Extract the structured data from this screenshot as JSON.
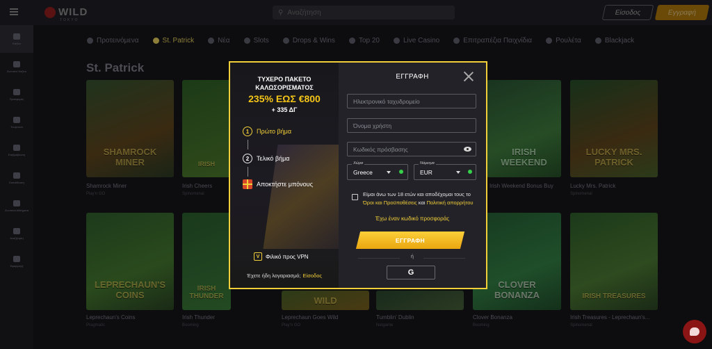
{
  "topbar": {
    "logo": "WILD",
    "logo_sub": "TOKYO",
    "search_placeholder": "Αναζήτηση",
    "login_label": "Είσοδος",
    "register_label": "Εγγραφή"
  },
  "sidebar": {
    "items": [
      {
        "label": "Καζίνο",
        "icon": "casino-icon"
      },
      {
        "label": "Ζωντανό Καζίνο",
        "icon": "home-icon"
      },
      {
        "label": "Προσφορές",
        "icon": "gift-icon"
      },
      {
        "label": "Τουρνουά",
        "icon": "trophy-icon"
      },
      {
        "label": "Επιβράβευση",
        "icon": "star-icon"
      },
      {
        "label": "Εκπαίδευση",
        "icon": "bulb-icon"
      },
      {
        "label": "Ζωντανά Αθλήματα",
        "icon": "ball-icon"
      },
      {
        "label": "Αναζήτηση",
        "icon": "search-icon"
      },
      {
        "label": "Εφαρμογή",
        "icon": "app-icon"
      }
    ]
  },
  "categories": [
    "Προτεινόμενα",
    "St. Patrick",
    "Νέα",
    "Slots",
    "Drops & Wins",
    "Top 20",
    "Live Casino",
    "Επιτραπέζια Παιχνίδια",
    "Ρουλέτα",
    "Blackjack"
  ],
  "section_title": "St. Patrick",
  "games_row1": [
    {
      "name": "Shamrock Miner",
      "provider": "Play'n GO",
      "art": "SHAMROCK MINER"
    },
    {
      "name": "Irish Cheers",
      "provider": "Spinomenal",
      "art": "IRISH"
    },
    {
      "name": "",
      "provider": "",
      "art": ""
    },
    {
      "name": "",
      "provider": "",
      "art": ""
    },
    {
      "name": "Irish Weekend Bonus Buy",
      "provider": "",
      "art": "IRISH WEEKEND"
    },
    {
      "name": "Lucky Mrs. Patrick",
      "provider": "Spinomenal",
      "art": "LUCKY MRS. PATRICK"
    }
  ],
  "games_row2": [
    {
      "name": "Leprechaun's Coins",
      "provider": "Pragmatic",
      "art": "LEPRECHAUN'S COINS"
    },
    {
      "name": "Irish Thunder",
      "provider": "Booming",
      "art": "IRISH THUNDER"
    },
    {
      "name": "Leprechaun Goes Wild",
      "provider": "Play'n GO",
      "art": "WILD"
    },
    {
      "name": "Tumblin' Dublin",
      "provider": "Netgame",
      "art": ""
    },
    {
      "name": "Clover Bonanza",
      "provider": "Booming",
      "art": "CLOVER BONANZA"
    },
    {
      "name": "Irish Treasures - Leprechaun's...",
      "provider": "Spinomenal",
      "art": "IRISH TREASURES"
    }
  ],
  "modal": {
    "promo": {
      "headline_line1": "ΤΥΧΕΡΟ ΠΑΚΕΤΟ",
      "headline_line2": "ΚΑΛΩΣΟΡΙΣΜΑΤΟΣ",
      "amount": "235% ΕΩΣ €800",
      "free_spins": "+ 335 ΔΓ",
      "step1_num": "1",
      "step1_label": "Πρώτο βήμα",
      "step2_num": "2",
      "step2_label": "Τελικό βήμα",
      "step3_label": "Αποκτήστε μπόνους",
      "vpn_label": "Φιλικό προς VPN",
      "have_account": "Έχετε ήδη λογαριασμό;",
      "login_link": "Είσοδος"
    },
    "form": {
      "title": "ΕΓΓΡΑΦΗ",
      "email_placeholder": "Ηλεκτρονικό ταχυδρομείο",
      "username_placeholder": "Όνομα χρήστη",
      "password_placeholder": "Κωδικός πρόσβασης",
      "country_label": "Χώρα",
      "country_value": "Greece",
      "currency_label": "Νόμισμα",
      "currency_value": "EUR",
      "terms_text": "Είμαι άνω των 18 ετών και αποδέχομαι τους το",
      "terms_link": "Όροι και Προϋποθέσεις",
      "terms_and": "και",
      "privacy_link": "Πολιτική απορρήτου",
      "promo_code": "Έχω έναν κωδικό προσφοράς",
      "submit_label": "ΕΓΓΡΑΦΗ",
      "or_label": "ή",
      "google_label": "G"
    }
  },
  "colors": {
    "accent": "#f3d03a",
    "status_green": "#37d04a",
    "modal_bg": "#222228"
  }
}
